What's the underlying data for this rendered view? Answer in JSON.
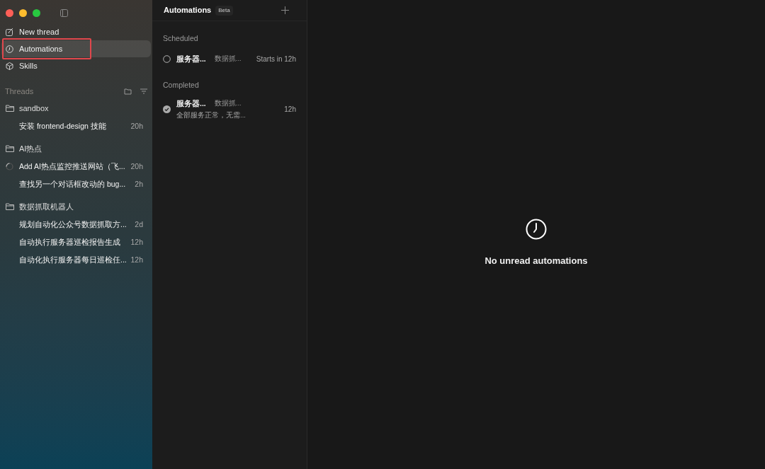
{
  "nav": [
    {
      "label": "New thread",
      "kind": "compose",
      "selected": false,
      "highlighted": false
    },
    {
      "label": "Automations",
      "kind": "schedule",
      "selected": true,
      "highlighted": true
    },
    {
      "label": "Skills",
      "kind": "skill",
      "selected": false,
      "highlighted": false
    }
  ],
  "threads": {
    "title": "Threads",
    "groups": [
      {
        "name": "sandbox",
        "children": [
          {
            "title": "安装 frontend-design 技能",
            "time": "20h",
            "running": false
          }
        ]
      },
      {
        "name": "AI热点",
        "children": [
          {
            "title": "Add AI热点监控推送网站（飞...",
            "time": "20h",
            "running": true
          },
          {
            "title": "查找另一个对话框改动的 bug...",
            "time": "2h",
            "running": false
          }
        ]
      },
      {
        "name": "数据抓取机器人",
        "children": [
          {
            "title": "规划自动化公众号数据抓取方...",
            "time": "2d",
            "running": false
          },
          {
            "title": "自动执行服务器巡检报告生成",
            "time": "12h",
            "running": false
          },
          {
            "title": "自动化执行服务器每日巡检任...",
            "time": "12h",
            "running": false
          }
        ]
      }
    ]
  },
  "automations": {
    "title": "Automations",
    "badge": "Beta",
    "sections": [
      {
        "title": "Scheduled",
        "items": [
          {
            "name": "服务器...",
            "project": "数据抓...",
            "time": "Starts in 12h",
            "completed": false
          }
        ]
      },
      {
        "title": "Completed",
        "items": [
          {
            "name": "服务器...",
            "project": "数据抓...",
            "summary": "全部服务正常，无需...",
            "time": "12h",
            "completed": true
          }
        ]
      }
    ]
  },
  "empty_state": {
    "message": "No unread automations"
  }
}
